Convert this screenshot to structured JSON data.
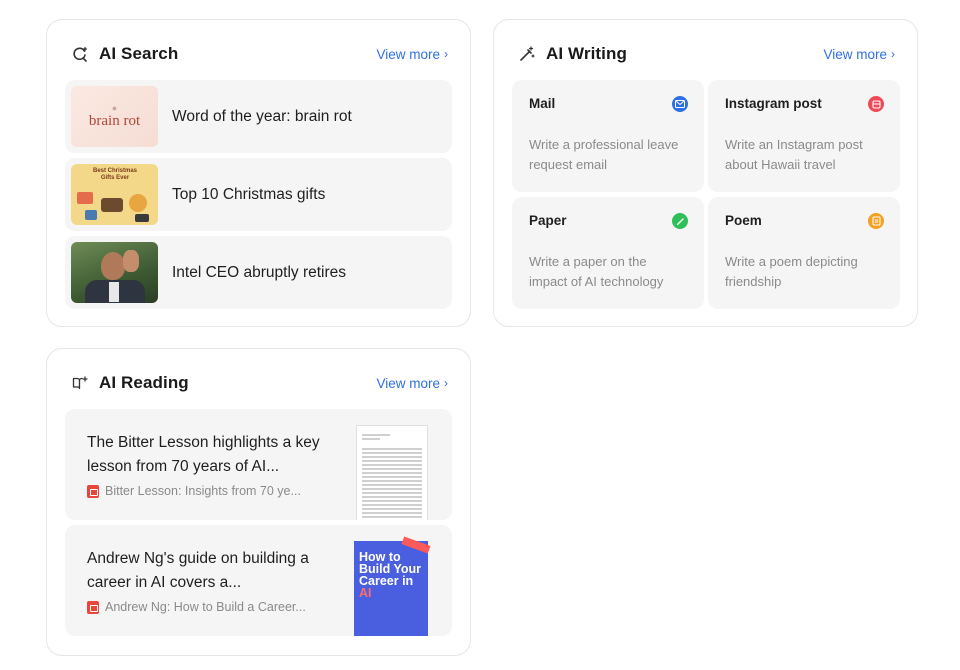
{
  "search": {
    "title": "AI Search",
    "view_more": "View more",
    "items": [
      {
        "title": "Word of the year: brain rot",
        "thumb_text": "brain rot"
      },
      {
        "title": "Top 10 Christmas gifts",
        "thumb_text": "Best Christmas Gifts Ever"
      },
      {
        "title": "Intel CEO abruptly retires"
      }
    ]
  },
  "writing": {
    "title": "AI Writing",
    "view_more": "View more",
    "tiles": [
      {
        "title": "Mail",
        "desc": "Write a professional leave request email",
        "icon": "mail-icon",
        "color": "#2f6fe4"
      },
      {
        "title": "Instagram post",
        "desc": "Write an Instagram post about Hawaii travel",
        "icon": "instagram-icon",
        "color": "#f04a5a"
      },
      {
        "title": "Paper",
        "desc": "Write a paper on the impact of AI technology",
        "icon": "pencil-icon",
        "color": "#2fbf5a"
      },
      {
        "title": "Poem",
        "desc": "Write a poem depicting friendship",
        "icon": "poem-icon",
        "color": "#f5a020"
      }
    ]
  },
  "reading": {
    "title": "AI Reading",
    "view_more": "View more",
    "items": [
      {
        "text": "The Bitter Lesson highlights a key lesson from 70 years of AI...",
        "source": "Bitter Lesson: Insights from 70 ye..."
      },
      {
        "text": "Andrew Ng's guide on building a career in AI covers a...",
        "source": "Andrew Ng: How to Build a Career...",
        "book_title_1": "How to Build Your Career in",
        "book_title_2": "AI"
      }
    ]
  }
}
